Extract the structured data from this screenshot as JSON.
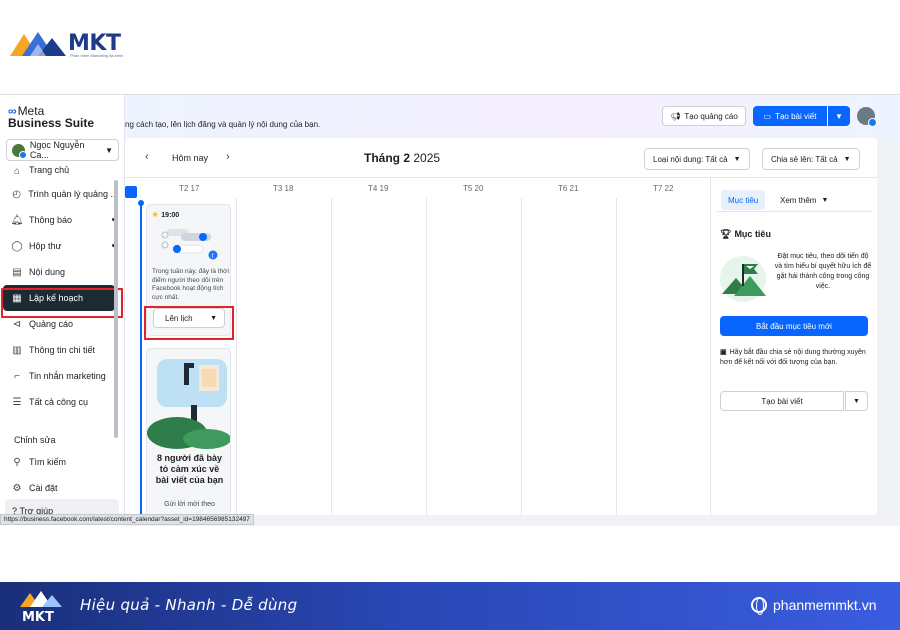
{
  "brand": {
    "logo_text": "MKT",
    "logo_subtext": "Phần mềm Marketing đa kênh",
    "slogan": "Hiệu quả - Nhanh  - Dễ dùng",
    "website": "phanmemmkt.vn",
    "colors": {
      "primary": "#1e3a8a",
      "accent": "#f5a623",
      "banner": "#2a47b5"
    }
  },
  "app": {
    "meta_logo": "Meta",
    "suite_name": "Business Suite",
    "account_name": "Ngọc Nguyễn Ca...",
    "accent_color": "#0866ff",
    "highlight_color": "#e0242b"
  },
  "sidebar": {
    "items": [
      {
        "label": "Trang chủ",
        "icon": "home-icon"
      },
      {
        "label": "Trình quản lý quảng ...",
        "icon": "ads-manager-icon"
      },
      {
        "label": "Thông báo",
        "icon": "bell-icon"
      },
      {
        "label": "Hộp thư",
        "icon": "chat-icon"
      },
      {
        "label": "Nội dung",
        "icon": "content-icon"
      },
      {
        "label": "Lập kế hoạch",
        "icon": "calendar-icon"
      },
      {
        "label": "Quảng cáo",
        "icon": "megaphone-icon"
      },
      {
        "label": "Thông tin chi tiết",
        "icon": "chart-icon"
      },
      {
        "label": "Tin nhắn marketing",
        "icon": "message-icon"
      },
      {
        "label": "Tất cả công cụ",
        "icon": "menu-icon"
      }
    ],
    "section_label": "Chỉnh sửa",
    "bottom_items": [
      {
        "label": "Tìm kiếm",
        "icon": "search-icon"
      },
      {
        "label": "Cài đặt",
        "icon": "gear-icon"
      }
    ],
    "help_label": "Trợ giúp"
  },
  "header": {
    "intro_text": "ng cách tạo, lên lịch đăng và quản lý nội dung của bạn.",
    "ads_button": "Tạo quảng cáo",
    "post_button": "Tạo bài viết"
  },
  "calendar": {
    "today_label": "Hôm nay",
    "month_label": "Tháng 2",
    "year_label": "2025",
    "filter_content": "Loại nội dung: Tất cả",
    "filter_share": "Chia sẻ lên: Tất cả",
    "days": [
      "T2 17",
      "T3 18",
      "T4 19",
      "T5 20",
      "T6 21",
      "T7 22"
    ],
    "card1": {
      "time": "19:00",
      "description": "Trong tuần này, đây là thời điểm người theo dõi trên Facebook hoạt động tích cực nhất.",
      "schedule_button": "Lên lịch"
    },
    "card2": {
      "title": "8 người đã bày tỏ cảm xúc về bài viết của bạn",
      "subtitle": "Gửi lời mời theo"
    }
  },
  "right_panel": {
    "tab_goals": "Mục tiêu",
    "tab_more": "Xem thêm",
    "goal_title": "Mục tiêu",
    "goal_text": "Đặt mục tiêu, theo dõi tiến độ và tìm hiểu bí quyết hữu ích để gặt hái thành công trong công việc.",
    "goal_button": "Bắt đầu mục tiêu mới",
    "tip_text": "Hãy bắt đầu chia sẻ nội dung thường xuyên hơn để kết nối với đối tượng của bạn.",
    "post_button": "Tạo bài viết"
  },
  "status_url": "https://business.facebook.com/latest/content_calendar?asset_id=1984656985132497"
}
